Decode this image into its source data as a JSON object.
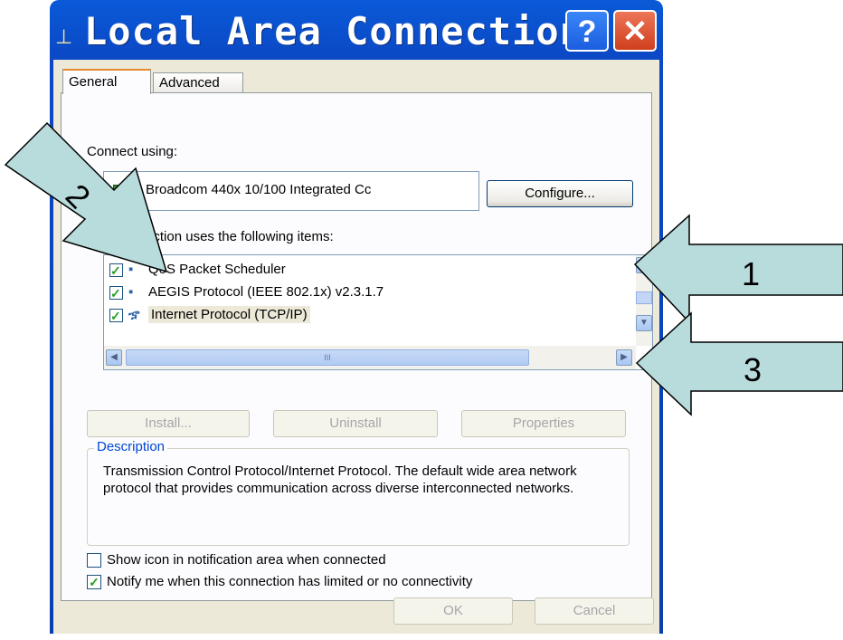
{
  "window": {
    "title": "Local Area Connection...",
    "help_label": "?",
    "close_label": "✕"
  },
  "tabs": [
    {
      "label": "General",
      "active": true
    },
    {
      "label": "Advanced",
      "active": false
    }
  ],
  "connect_using_label": "Connect using:",
  "adapter_name": "Broadcom 440x 10/100 Integrated Cc",
  "configure_label": "Configure...",
  "items_label": "This connection uses the following items:",
  "items": [
    {
      "label": "QoS Packet Scheduler",
      "checked": true,
      "selected": false
    },
    {
      "label": "AEGIS Protocol (IEEE 802.1x) v2.3.1.7",
      "checked": true,
      "selected": false
    },
    {
      "label": "Internet Protocol (TCP/IP)",
      "checked": true,
      "selected": true
    }
  ],
  "scrollbar": {
    "thumb_grip": "III",
    "up": "▲",
    "down": "▼",
    "left": "◀",
    "right": "▶"
  },
  "buttons": {
    "install": "Install...",
    "uninstall": "Uninstall",
    "properties": "Properties",
    "ok": "OK",
    "cancel": "Cancel"
  },
  "description": {
    "title": "Description",
    "text": "Transmission Control Protocol/Internet Protocol. The default wide area network protocol that provides communication across diverse interconnected networks."
  },
  "options": {
    "show_icon": {
      "label": "Show icon in notification area when connected",
      "checked": false
    },
    "notify": {
      "label": "Notify me when this connection has limited or no connectivity",
      "checked": true
    }
  },
  "annotations": {
    "arrow1": "1",
    "arrow2": "2",
    "arrow3": "3",
    "arrow_color": "#b8dbdc"
  },
  "colors": {
    "titlebar": "#0a5ad8",
    "dialog_bg": "#ece9d8",
    "close_button": "#cf3f1d"
  }
}
